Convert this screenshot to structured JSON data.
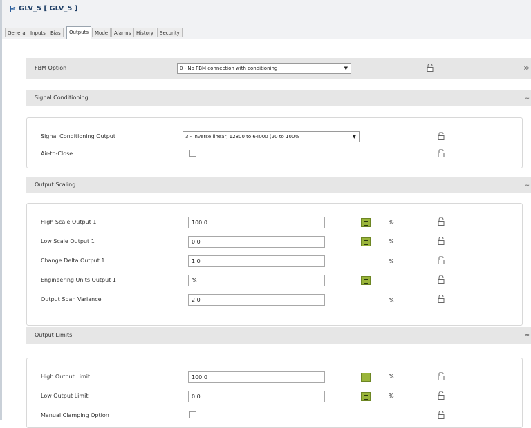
{
  "window": {
    "title": "GLV_5 [ GLV_5 ]"
  },
  "tabs": [
    {
      "label": "General"
    },
    {
      "label": "Inputs"
    },
    {
      "label": "Bias"
    },
    {
      "label": "Outputs",
      "active": true
    },
    {
      "label": "Mode"
    },
    {
      "label": "Alarms"
    },
    {
      "label": "History"
    },
    {
      "label": "Security"
    }
  ],
  "fbm_option": {
    "label": "FBM Option",
    "value": "0 - No FBM connection with conditioning"
  },
  "signal_conditioning": {
    "title": "Signal Conditioning",
    "output_label": "Signal Conditioning Output",
    "output_value": "3 - Inverse linear, 12800 to 64000 (20 to 100%",
    "air_to_close_label": "Air-to-Close"
  },
  "output_scaling": {
    "title": "Output Scaling",
    "rows": [
      {
        "label": "High Scale Output 1",
        "value": "100.0",
        "unit": "%"
      },
      {
        "label": "Low Scale Output 1",
        "value": "0.0",
        "unit": "%"
      },
      {
        "label": "Change Delta Output 1",
        "value": "1.0",
        "unit": "%"
      },
      {
        "label": "Engineering Units Output 1",
        "value": "%",
        "unit": ""
      },
      {
        "label": "Output Span Variance",
        "value": "2.0",
        "unit": "%"
      }
    ]
  },
  "output_limits": {
    "title": "Output Limits",
    "rows": [
      {
        "label": "High Output Limit",
        "value": "100.0",
        "unit": "%"
      },
      {
        "label": "Low Output Limit",
        "value": "0.0",
        "unit": "%"
      }
    ],
    "manual_clamping_label": "Manual Clamping Option"
  },
  "icons": {
    "lock": "padlock-open-icon",
    "lookup": "lookup-button-icon",
    "collapse": "collapse-arrow-icon"
  },
  "colors": {
    "band": "#e6e6e6",
    "lookup_button": "#9ab53a",
    "title_text": "#1f3f66"
  }
}
